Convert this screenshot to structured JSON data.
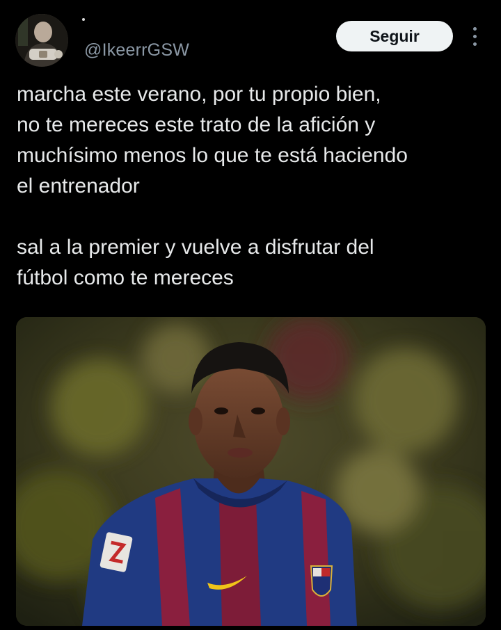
{
  "tweet": {
    "author": {
      "handle": "@IkeerrGSW",
      "avatar_icon": "profile-photo"
    },
    "follow_label": "Seguir",
    "more_icon": "more-vertical-icon",
    "text_paragraphs": [
      [
        "marcha este verano, por tu propio bien,",
        "no te mereces este trato de la afición y",
        "muchísimo menos lo que te está haciendo",
        "el entrenador"
      ],
      [
        "sal a la premier y vuelve a disfrutar del",
        "fútbol como te mereces"
      ]
    ],
    "media": {
      "kind": "photo",
      "description_icon": "player-photo"
    }
  },
  "colors": {
    "background": "#000000",
    "text": "#e7e9ea",
    "muted": "#8b98a5",
    "button_bg": "#eff3f4",
    "button_text": "#0f1419"
  }
}
